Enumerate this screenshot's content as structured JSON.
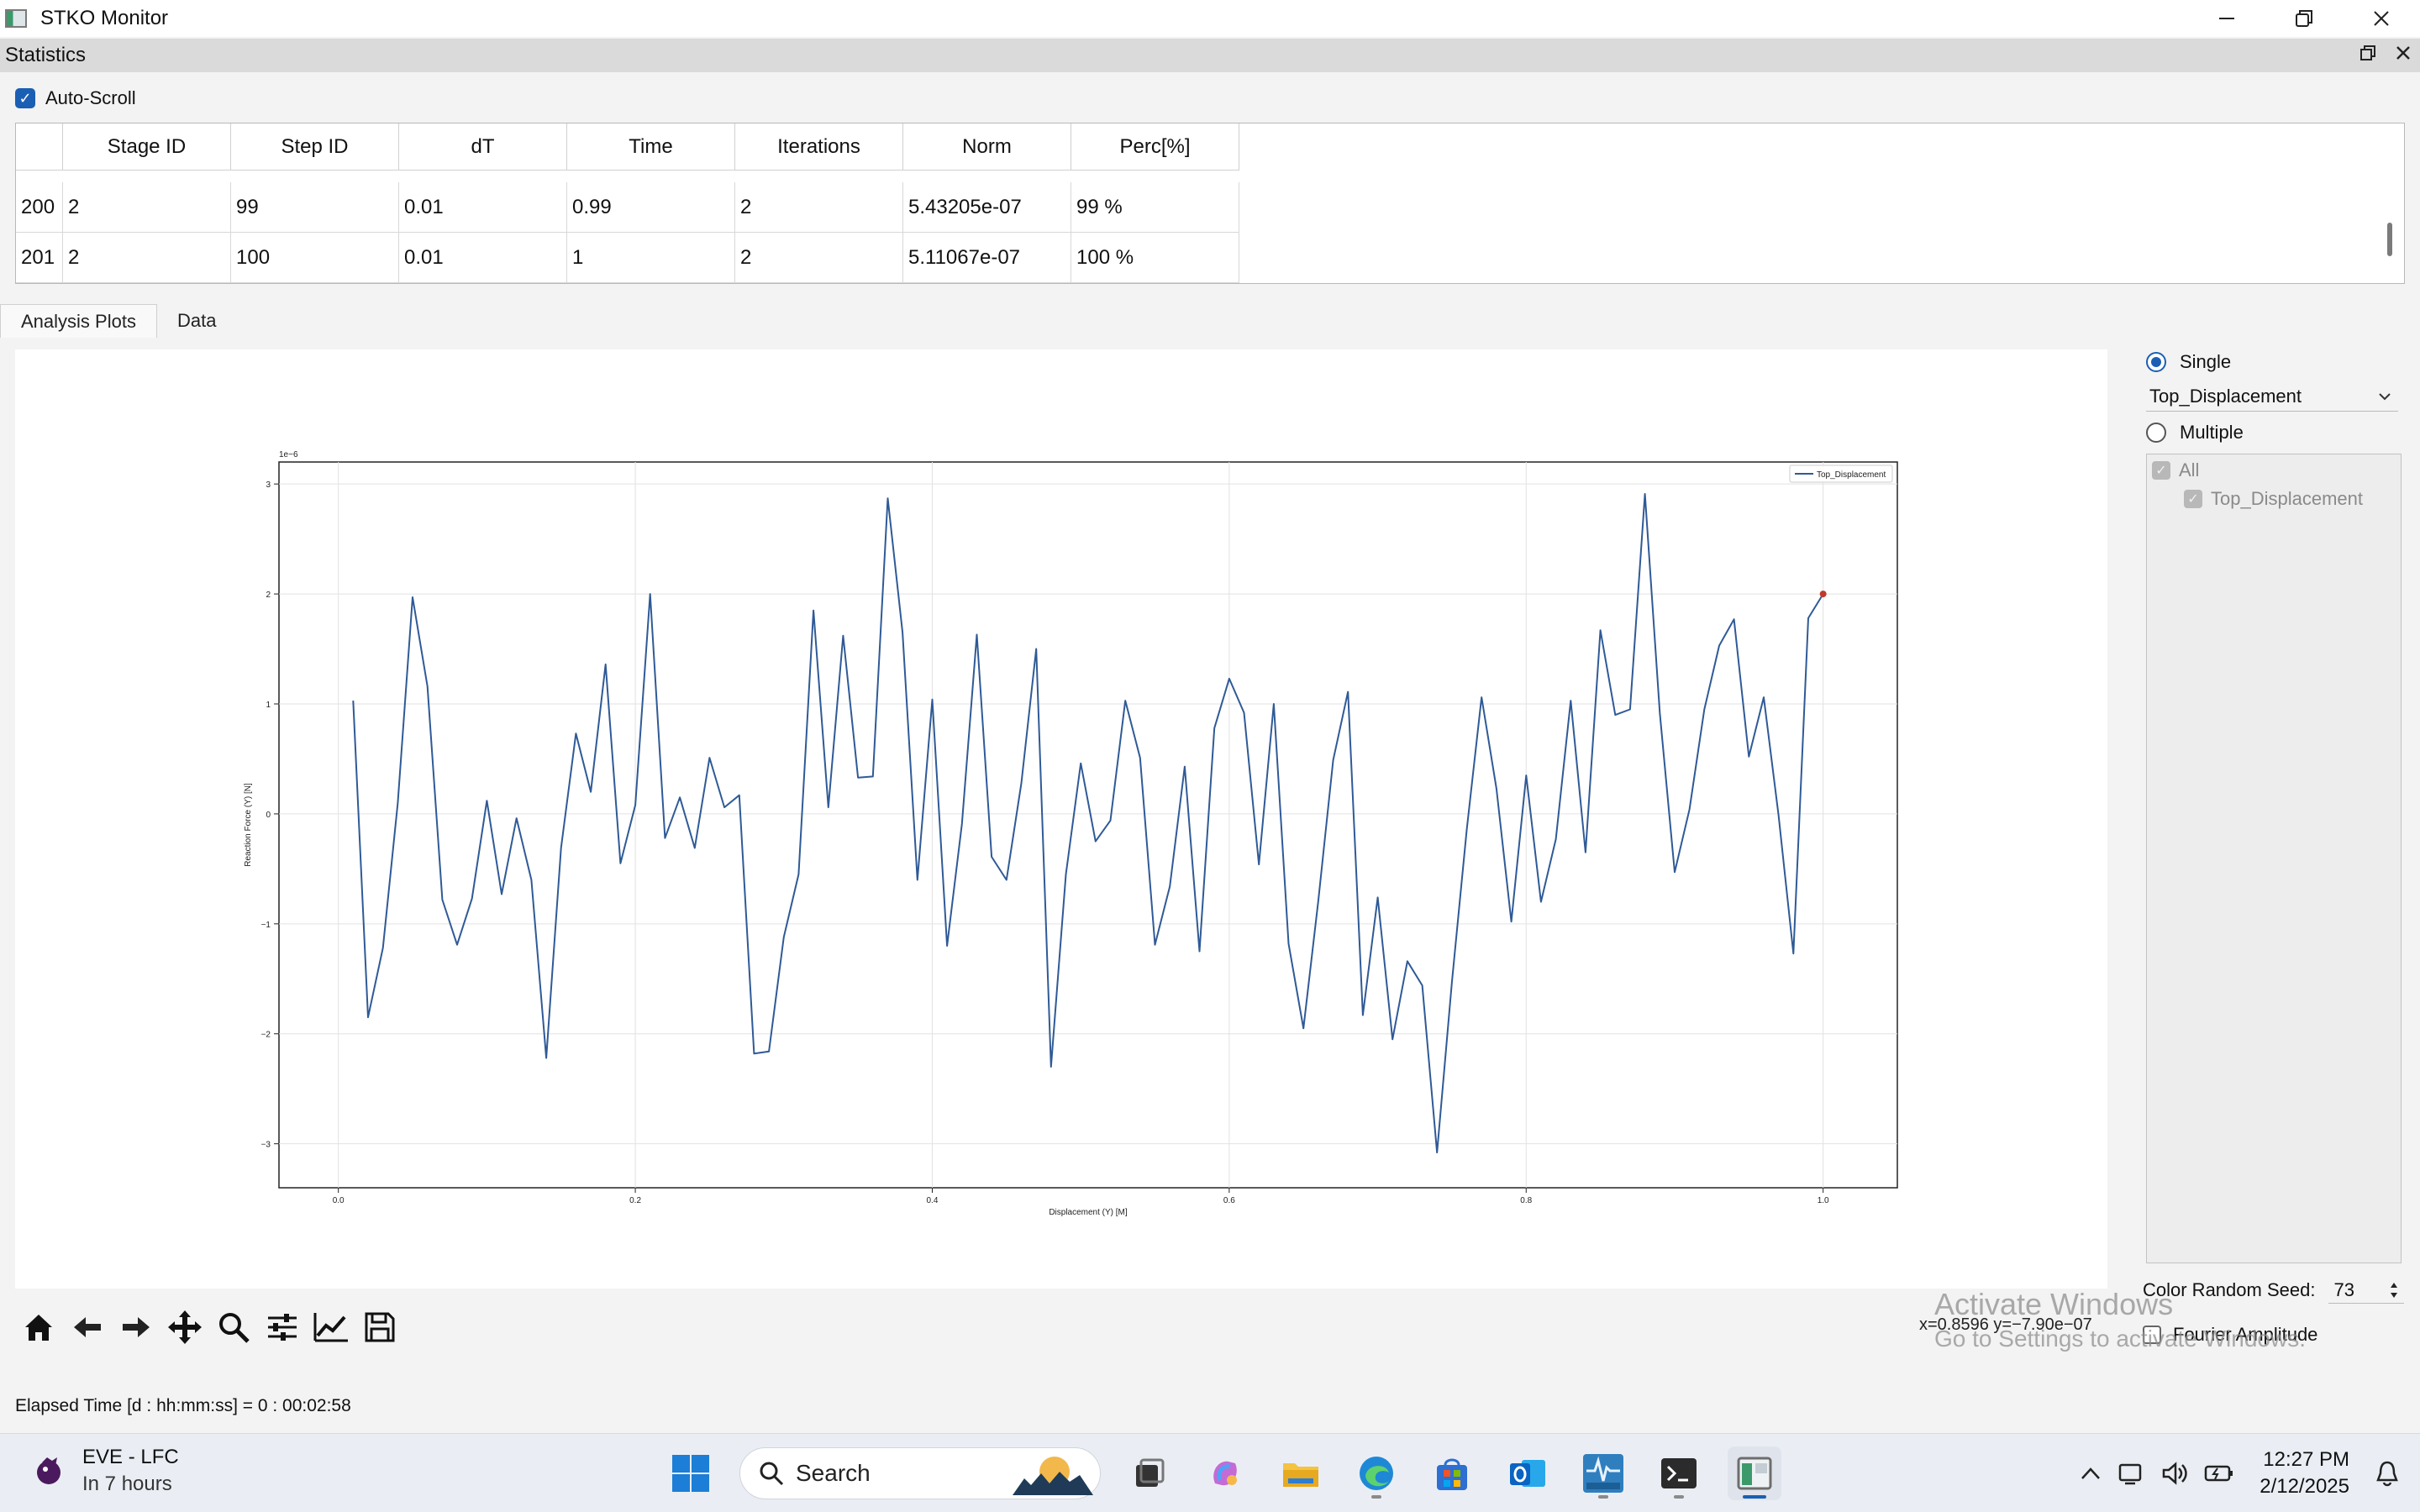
{
  "window": {
    "title": "STKO Monitor",
    "controls": [
      "minimize",
      "restore",
      "close"
    ]
  },
  "dock": {
    "title": "Statistics"
  },
  "auto_scroll": {
    "label": "Auto-Scroll",
    "checked": true
  },
  "table": {
    "columns": [
      "Stage ID",
      "Step ID",
      "dT",
      "Time",
      "Iterations",
      "Norm",
      "Perc[%]"
    ],
    "rows": [
      {
        "index": "200",
        "stage": "2",
        "step": "99",
        "dt": "0.01",
        "time": "0.99",
        "iterations": "2",
        "norm": "5.43205e-07",
        "perc": "99 %"
      },
      {
        "index": "201",
        "stage": "2",
        "step": "100",
        "dt": "0.01",
        "time": "1",
        "iterations": "2",
        "norm": "5.11067e-07",
        "perc": "100 %"
      }
    ]
  },
  "tabs": [
    {
      "label": "Analysis Plots",
      "active": true
    },
    {
      "label": "Data",
      "active": false
    }
  ],
  "chart_data": {
    "type": "line",
    "xlabel": "Displacement (Y) [M]",
    "ylabel": "Reaction Force (Y) [N]",
    "y_scale_label": "1e−6",
    "xlim": [
      -0.04,
      1.05
    ],
    "ylim": [
      -3.4,
      3.2
    ],
    "x_ticks": [
      "0.0",
      "0.2",
      "0.4",
      "0.6",
      "0.8",
      "1.0"
    ],
    "y_ticks": [
      "3",
      "2",
      "1",
      "0",
      "−1",
      "−2",
      "−3"
    ],
    "grid": true,
    "legend_position": "top-right",
    "series": [
      {
        "name": "Top_Displacement",
        "color": "#2f5a96",
        "x": [
          0.01,
          0.02,
          0.03,
          0.04,
          0.05,
          0.06,
          0.07,
          0.08,
          0.09,
          0.1,
          0.11,
          0.12,
          0.13,
          0.14,
          0.15,
          0.16,
          0.17,
          0.18,
          0.19,
          0.2,
          0.21,
          0.22,
          0.23,
          0.24,
          0.25,
          0.26,
          0.27,
          0.28,
          0.29,
          0.3,
          0.31,
          0.32,
          0.33,
          0.34,
          0.35,
          0.36,
          0.37,
          0.38,
          0.39,
          0.4,
          0.41,
          0.42,
          0.43,
          0.44,
          0.45,
          0.46,
          0.47,
          0.48,
          0.49,
          0.5,
          0.51,
          0.52,
          0.53,
          0.54,
          0.55,
          0.56,
          0.57,
          0.58,
          0.59,
          0.6,
          0.61,
          0.62,
          0.63,
          0.64,
          0.65,
          0.66,
          0.67,
          0.68,
          0.69,
          0.7,
          0.71,
          0.72,
          0.73,
          0.74,
          0.75,
          0.76,
          0.77,
          0.78,
          0.79,
          0.8,
          0.81,
          0.82,
          0.83,
          0.84,
          0.85,
          0.86,
          0.87,
          0.88,
          0.89,
          0.9,
          0.91,
          0.92,
          0.93,
          0.94,
          0.95,
          0.96,
          0.97,
          0.98,
          0.99,
          1.0
        ],
        "y": [
          1.03,
          -1.85,
          -1.22,
          0.1,
          1.97,
          1.16,
          -0.78,
          -1.19,
          -0.77,
          0.12,
          -0.73,
          -0.04,
          -0.6,
          -2.22,
          -0.31,
          0.73,
          0.2,
          1.36,
          -0.45,
          0.08,
          2.0,
          -0.22,
          0.15,
          -0.31,
          0.51,
          0.06,
          0.17,
          -2.18,
          -2.16,
          -1.12,
          -0.55,
          1.85,
          0.06,
          1.62,
          0.33,
          0.34,
          2.87,
          1.65,
          -0.6,
          1.04,
          -1.2,
          -0.09,
          1.63,
          -0.39,
          -0.6,
          0.28,
          1.5,
          -2.3,
          -0.55,
          0.46,
          -0.25,
          -0.06,
          1.03,
          0.51,
          -1.19,
          -0.66,
          0.43,
          -1.25,
          0.78,
          1.23,
          0.92,
          -0.46,
          1.0,
          -1.18,
          -1.95,
          -0.79,
          0.49,
          1.11,
          -1.83,
          -0.76,
          -2.05,
          -1.34,
          -1.56,
          -3.08,
          -1.53,
          -0.14,
          1.06,
          0.23,
          -0.98,
          0.35,
          -0.8,
          -0.23,
          1.03,
          -0.35,
          1.67,
          0.9,
          0.95,
          2.91,
          0.92,
          -0.53,
          0.04,
          0.95,
          1.53,
          1.77,
          0.52,
          1.06,
          -0.01,
          -1.27,
          1.78,
          2.0
        ]
      }
    ],
    "marker": {
      "x": 1.0,
      "y": 2.0,
      "color": "#c0392b"
    }
  },
  "plot_toolbar": {
    "buttons": [
      "home-icon",
      "back-icon",
      "forward-icon",
      "pan-icon",
      "zoom-icon",
      "configure-icon",
      "edit-curve-icon",
      "save-icon"
    ],
    "coordinates": "x=0.8596 y=−7.90e−07"
  },
  "right_panel": {
    "single_label": "Single",
    "single_selected": true,
    "dropdown_value": "Top_Displacement",
    "multiple_label": "Multiple",
    "list": [
      {
        "label": "All"
      },
      {
        "label": "Top_Displacement"
      }
    ],
    "seed_label": "Color Random Seed:",
    "seed_value": "73",
    "fourier_label": "Fourier Amplitude"
  },
  "watermark": {
    "line1": "Activate Windows",
    "line2": "Go to Settings to activate Windows."
  },
  "status": {
    "elapsed": "Elapsed Time [d : hh:mm:ss] = 0 : 00:02:58"
  },
  "taskbar": {
    "weather_title": "EVE - LFC",
    "weather_sub": "In 7 hours",
    "search_placeholder": "Search",
    "time": "12:27 PM",
    "date": "2/12/2025"
  }
}
